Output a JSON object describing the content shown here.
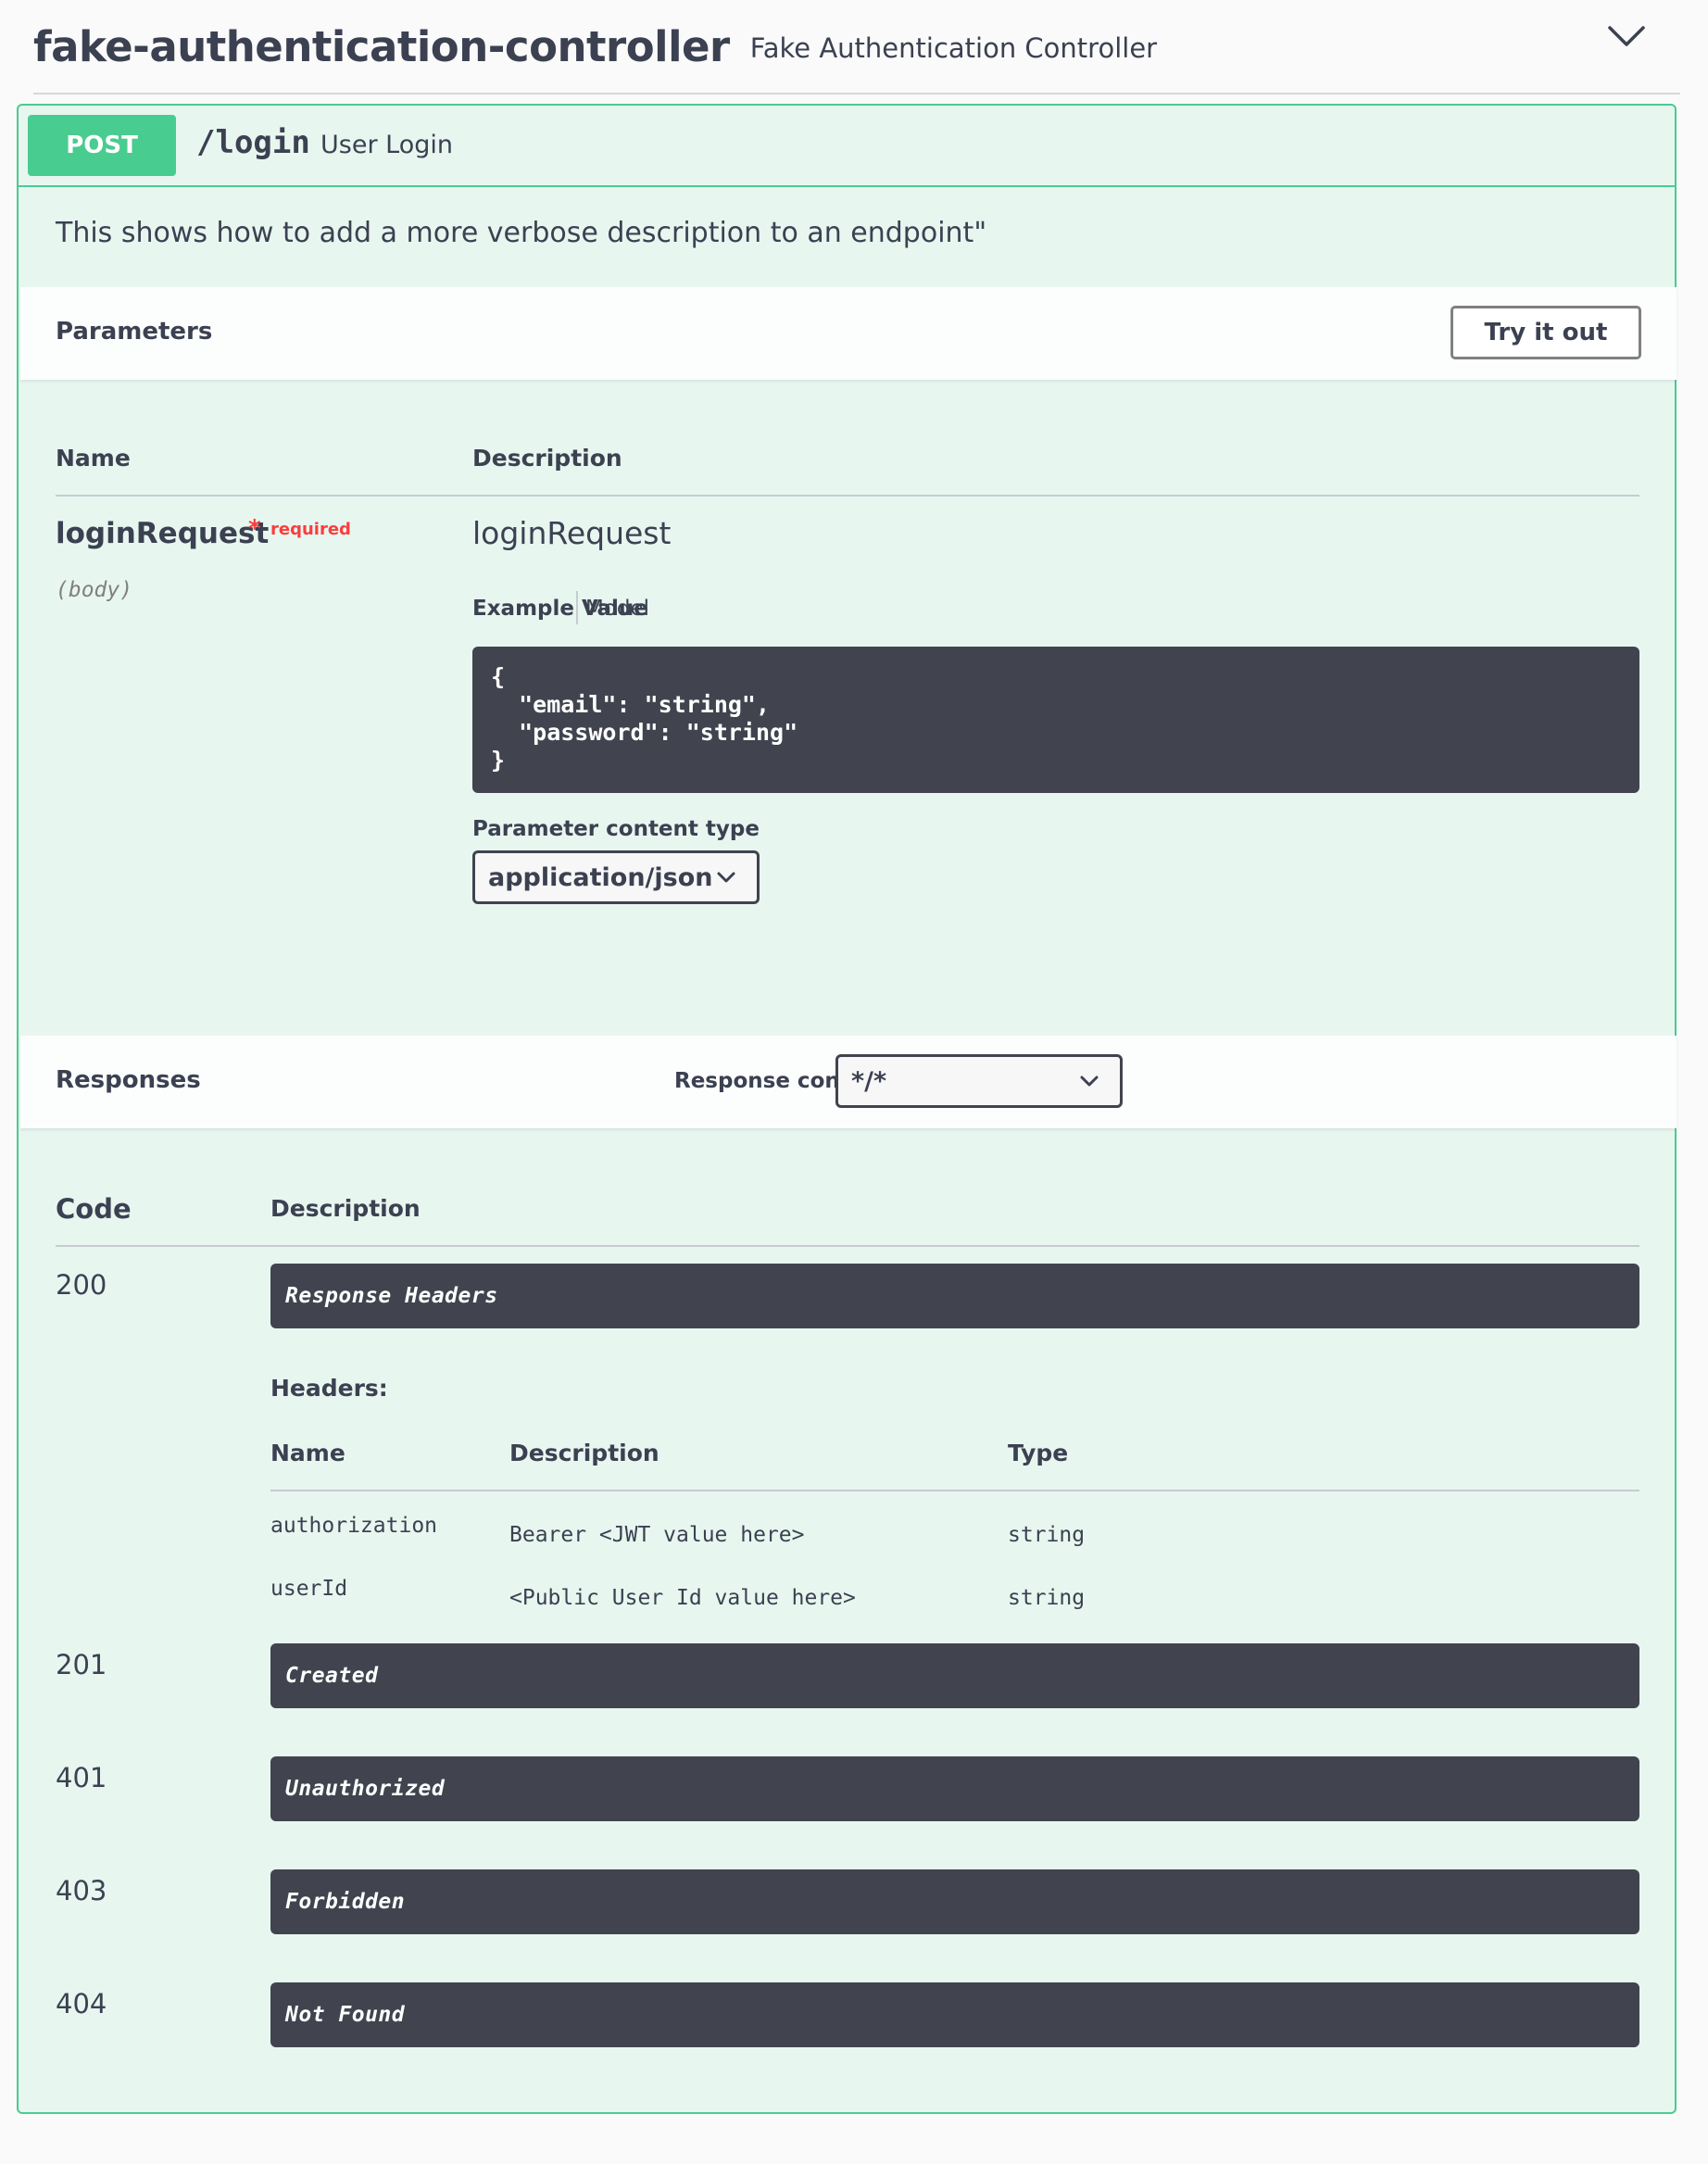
{
  "tag": {
    "name": "fake-authentication-controller",
    "description": "Fake Authentication Controller"
  },
  "operation": {
    "method": "POST",
    "path": "/login",
    "summary": "User Login",
    "description": "This shows how to add a more verbose description to an endpoint\""
  },
  "parameters": {
    "title": "Parameters",
    "try_it_out_label": "Try it out",
    "columns": {
      "name": "Name",
      "description": "Description"
    },
    "items": [
      {
        "name": "loginRequest",
        "required_star": "*",
        "required_label": "required",
        "in": "(body)",
        "description": "loginRequest",
        "tabs": {
          "example": "Example Value",
          "model": "Model"
        },
        "example_value": "{\n  \"email\": \"string\",\n  \"password\": \"string\"\n}",
        "content_type_label": "Parameter content type",
        "content_type_value": "application/json"
      }
    ]
  },
  "responses": {
    "title": "Responses",
    "content_type_label": "Response content type",
    "content_type_value": "*/*",
    "columns": {
      "code": "Code",
      "description": "Description"
    },
    "items": [
      {
        "code": "200",
        "description": "Response Headers"
      },
      {
        "code": "201",
        "description": "Created"
      },
      {
        "code": "401",
        "description": "Unauthorized"
      },
      {
        "code": "403",
        "description": "Forbidden"
      },
      {
        "code": "404",
        "description": "Not Found"
      }
    ],
    "headers": {
      "title": "Headers:",
      "columns": {
        "name": "Name",
        "description": "Description",
        "type": "Type"
      },
      "rows": [
        {
          "name": "authorization",
          "description": "Bearer <JWT value here>",
          "type": "string"
        },
        {
          "name": "userId",
          "description": "<Public User Id value here>",
          "type": "string"
        }
      ]
    }
  },
  "colors": {
    "post_accent": "#49cc90",
    "post_background": "#e8f6f0",
    "code_background": "#41444e",
    "required": "#f93e3e"
  },
  "icons": {
    "collapse": "chevron-down-icon",
    "select": "chevron-down-icon"
  }
}
